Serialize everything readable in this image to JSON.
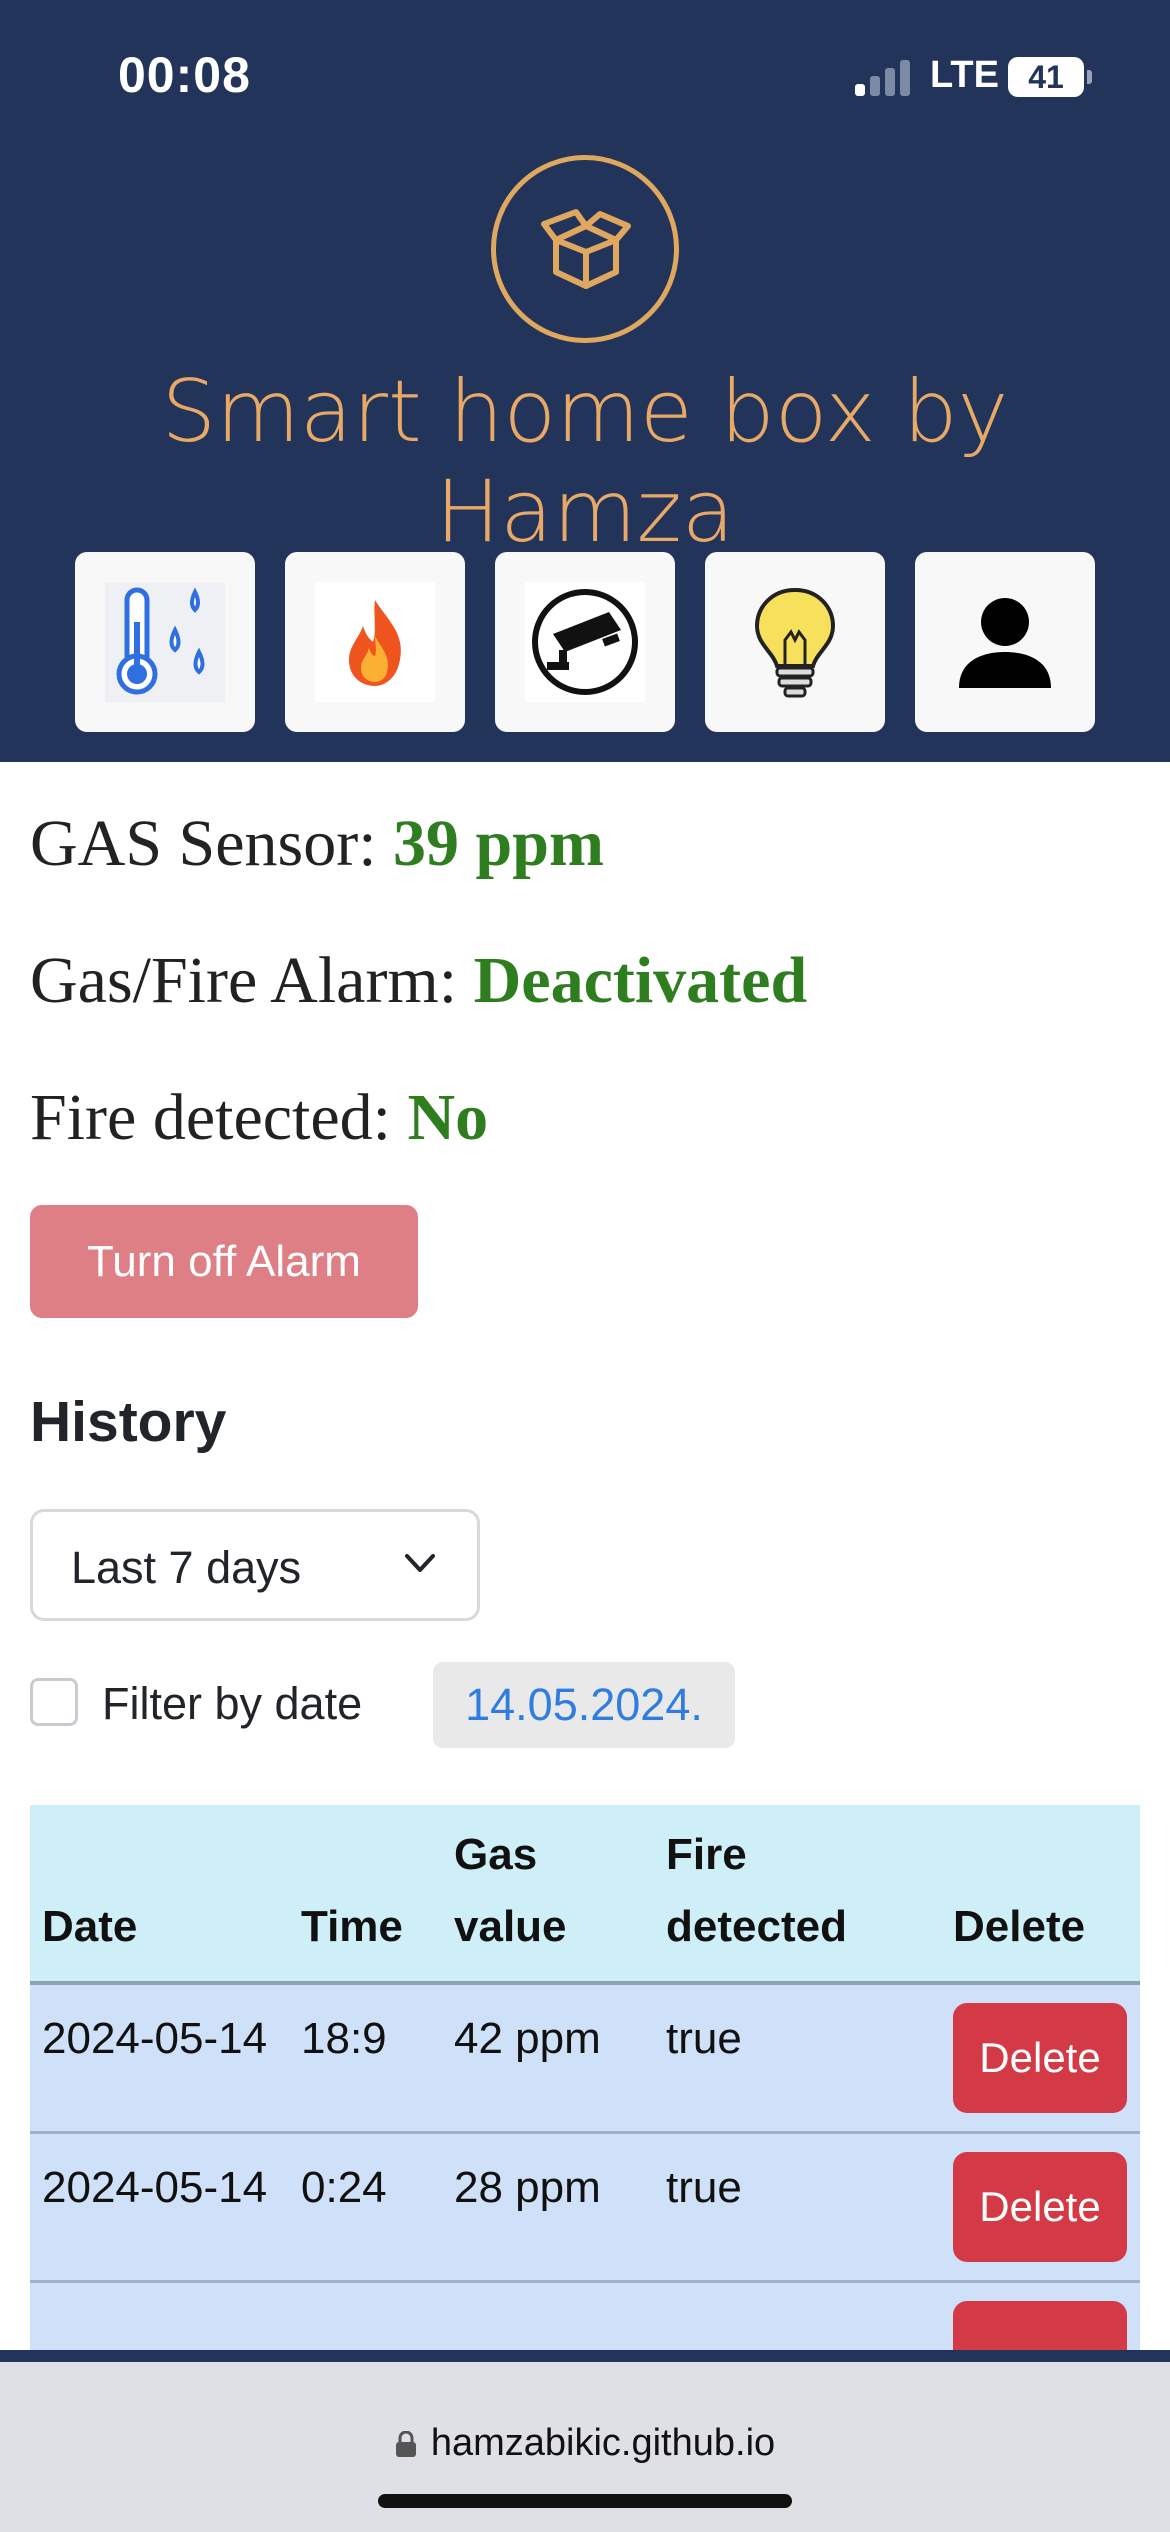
{
  "status_bar": {
    "time": "00:08",
    "network": "LTE",
    "battery": "41"
  },
  "header": {
    "title": "Smart home box by Hamza",
    "logo_icon": "open-box-icon",
    "colors": {
      "background": "#22345a",
      "accent": "#e8a966"
    }
  },
  "nav": {
    "items": [
      {
        "icon": "thermometer-humidity-icon"
      },
      {
        "icon": "fire-icon"
      },
      {
        "icon": "security-camera-icon"
      },
      {
        "icon": "light-bulb-icon"
      },
      {
        "icon": "user-icon"
      }
    ]
  },
  "sensors": {
    "gas_label": "GAS Sensor:",
    "gas_value": "39 ppm",
    "alarm_label": "Gas/Fire Alarm:",
    "alarm_value": "Deactivated",
    "fire_label": "Fire detected:",
    "fire_value": "No",
    "value_color": "#2e7d1e"
  },
  "alarm_button": {
    "label": "Turn off Alarm"
  },
  "history": {
    "title": "History",
    "range_selected": "Last 7 days",
    "filter_label": "Filter by date",
    "filter_checked": false,
    "filter_date": "14.05.2024.",
    "table": {
      "headers": {
        "date": "Date",
        "time": "Time",
        "gas": "Gas value",
        "fire": "Fire detected",
        "delete": "Delete"
      },
      "rows": [
        {
          "date": "2024-05-14",
          "time": "18:9",
          "gas": "42 ppm",
          "fire": "true",
          "delete_label": "Delete"
        },
        {
          "date": "2024-05-14",
          "time": "0:24",
          "gas": "28 ppm",
          "fire": "true",
          "delete_label": "Delete"
        },
        {
          "date": "",
          "time": "",
          "gas": "",
          "fire": "",
          "delete_label": ""
        }
      ]
    }
  },
  "browser": {
    "url": "hamzabikic.github.io"
  }
}
